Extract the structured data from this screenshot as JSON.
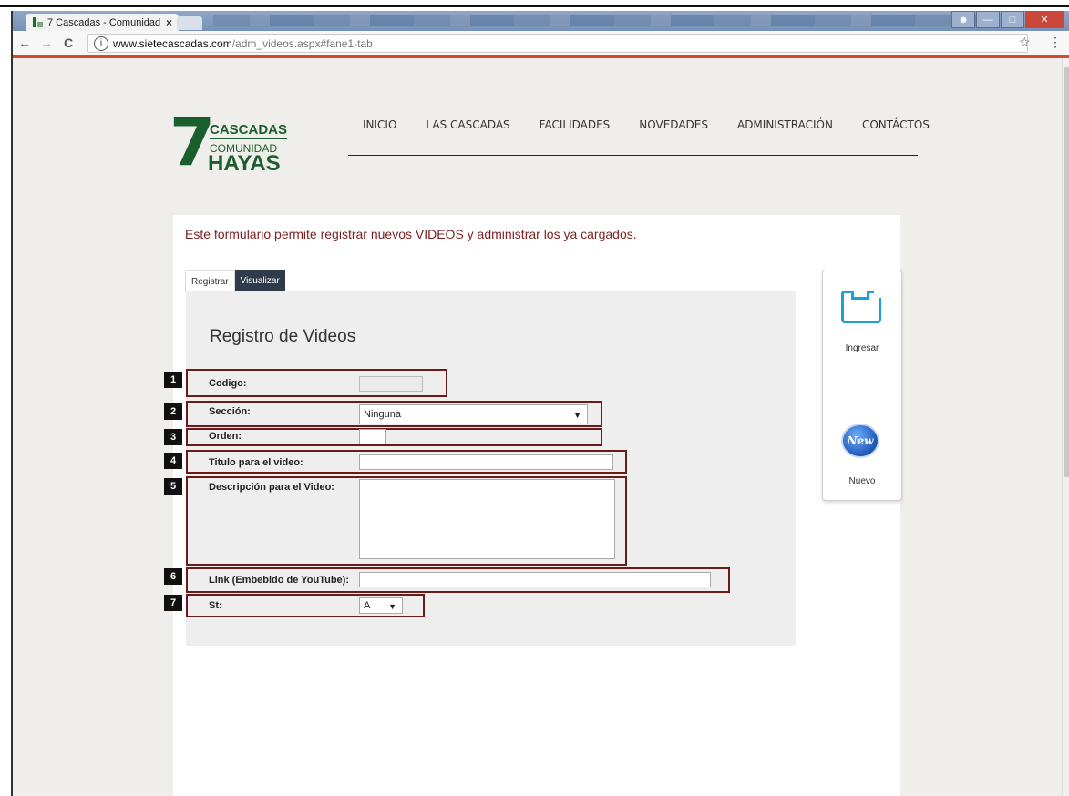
{
  "browser": {
    "tab_title": "7 Cascadas - Comunidad",
    "tab_close": "×",
    "url_host": "www.sietecascadas.com",
    "url_path": "/adm_videos.aspx#fane1-tab",
    "back": "←",
    "forward": "→",
    "reload": "C",
    "info": "i",
    "star": "☆",
    "menu": "⋮"
  },
  "logo": {
    "number": "7",
    "line1": "CASCADAS",
    "line2": "COMUNIDAD",
    "line3": "HAYAS"
  },
  "nav": [
    "INICIO",
    "LAS CASCADAS",
    "FACILIDADES",
    "NOVEDADES",
    "ADMINISTRACIÓN",
    "CONTÁCTOS"
  ],
  "intro": "Este formulario permite registrar nuevos VIDEOS y administrar los ya cargados.",
  "tabs": {
    "registrar": "Registrar",
    "visualizar": "Visualizar"
  },
  "form": {
    "title": "Registro de Videos",
    "codigo_label": "Codigo:",
    "codigo_value": "",
    "seccion_label": "Sección:",
    "seccion_value": "Ninguna",
    "orden_label": "Orden:",
    "orden_value": "",
    "titulo_label": "Titulo para el video:",
    "titulo_value": "",
    "descripcion_label": "Descripción para el Video:",
    "descripcion_value": "",
    "link_label": "Link (Embebido de YouTube):",
    "link_value": "",
    "st_label": "St:",
    "st_value": "A"
  },
  "markers": [
    "1",
    "2",
    "3",
    "4",
    "5",
    "6",
    "7"
  ],
  "side": {
    "ingresar": "Ingresar",
    "nuevo": "Nuevo",
    "new_icon_text": "New"
  },
  "colors": {
    "accent_red": "#d9472b",
    "brand_green": "#1b5e2e",
    "highlight": "#6b1a1a",
    "intro_text": "#7b1f1f"
  }
}
